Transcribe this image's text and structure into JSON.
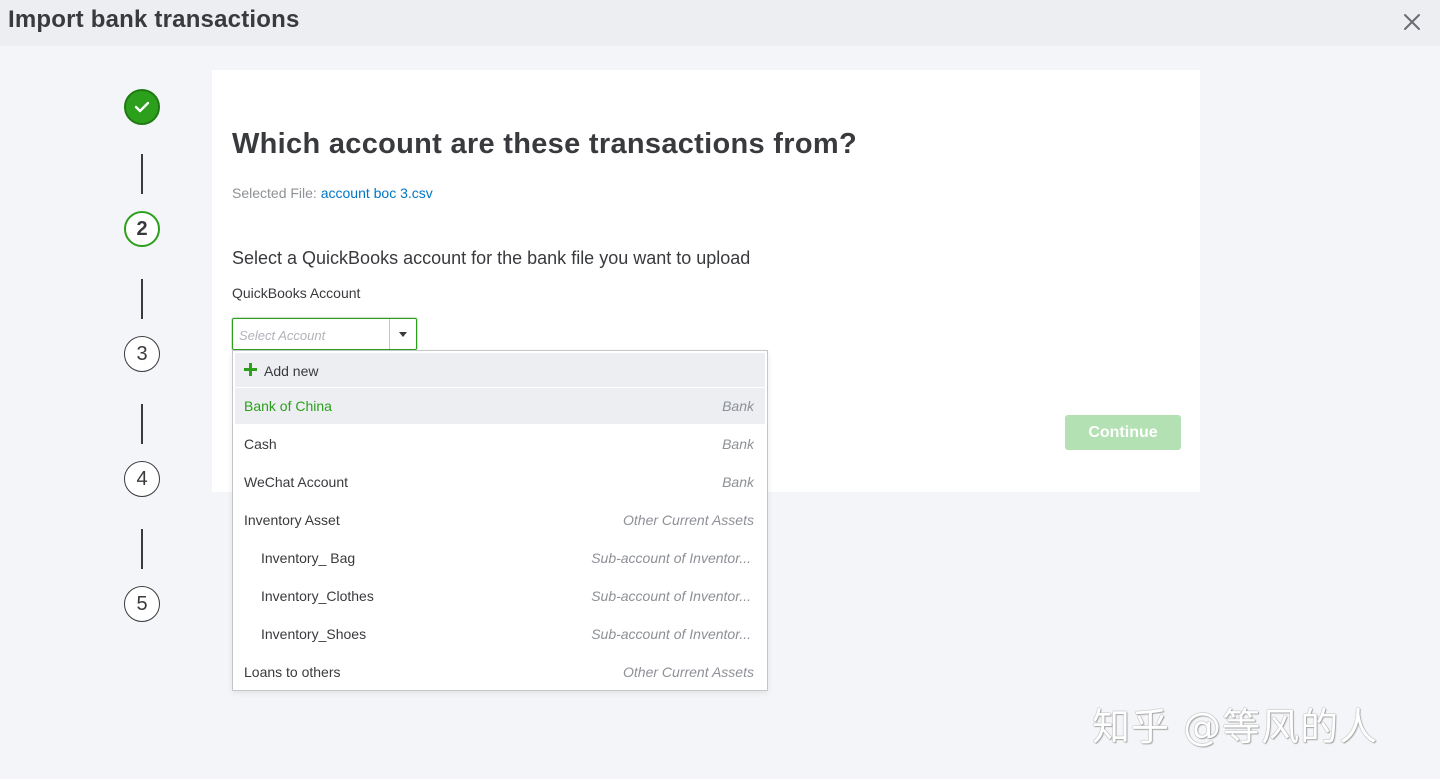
{
  "header": {
    "title": "Import bank transactions",
    "close_icon": "close-icon"
  },
  "stepper": {
    "steps": [
      {
        "label": "",
        "state": "done",
        "icon": "checkmark-icon"
      },
      {
        "label": "2",
        "state": "current"
      },
      {
        "label": "3",
        "state": "upcoming"
      },
      {
        "label": "4",
        "state": "upcoming"
      },
      {
        "label": "5",
        "state": "upcoming"
      }
    ]
  },
  "main": {
    "question": "Which account are these transactions from?",
    "selected_file_label": "Selected File:",
    "selected_file_name": "account boc 3.csv",
    "instruction": "Select a QuickBooks account for the bank file you want to upload",
    "field_label": "QuickBooks Account",
    "select_placeholder": "Select Account",
    "continue_label": "Continue"
  },
  "dropdown": {
    "add_new_label": "Add new",
    "items": [
      {
        "name": "Bank of China",
        "type": "Bank",
        "highlighted": true
      },
      {
        "name": "Cash",
        "type": "Bank"
      },
      {
        "name": "WeChat Account",
        "type": "Bank"
      },
      {
        "name": "Inventory Asset",
        "type": "Other Current Assets"
      },
      {
        "name": "Inventory_ Bag",
        "type": "Sub-account of Inventor...",
        "sub": true
      },
      {
        "name": "Inventory_Clothes",
        "type": "Sub-account of Inventor...",
        "sub": true
      },
      {
        "name": "Inventory_Shoes",
        "type": "Sub-account of Inventor...",
        "sub": true
      },
      {
        "name": "Loans to others",
        "type": "Other Current Assets"
      }
    ]
  },
  "watermark": "知乎 @等风的人",
  "colors": {
    "accent": "#2ca01c",
    "link": "#0077c5",
    "continue_disabled": "#b3e1b3",
    "background": "#f4f5f8"
  }
}
